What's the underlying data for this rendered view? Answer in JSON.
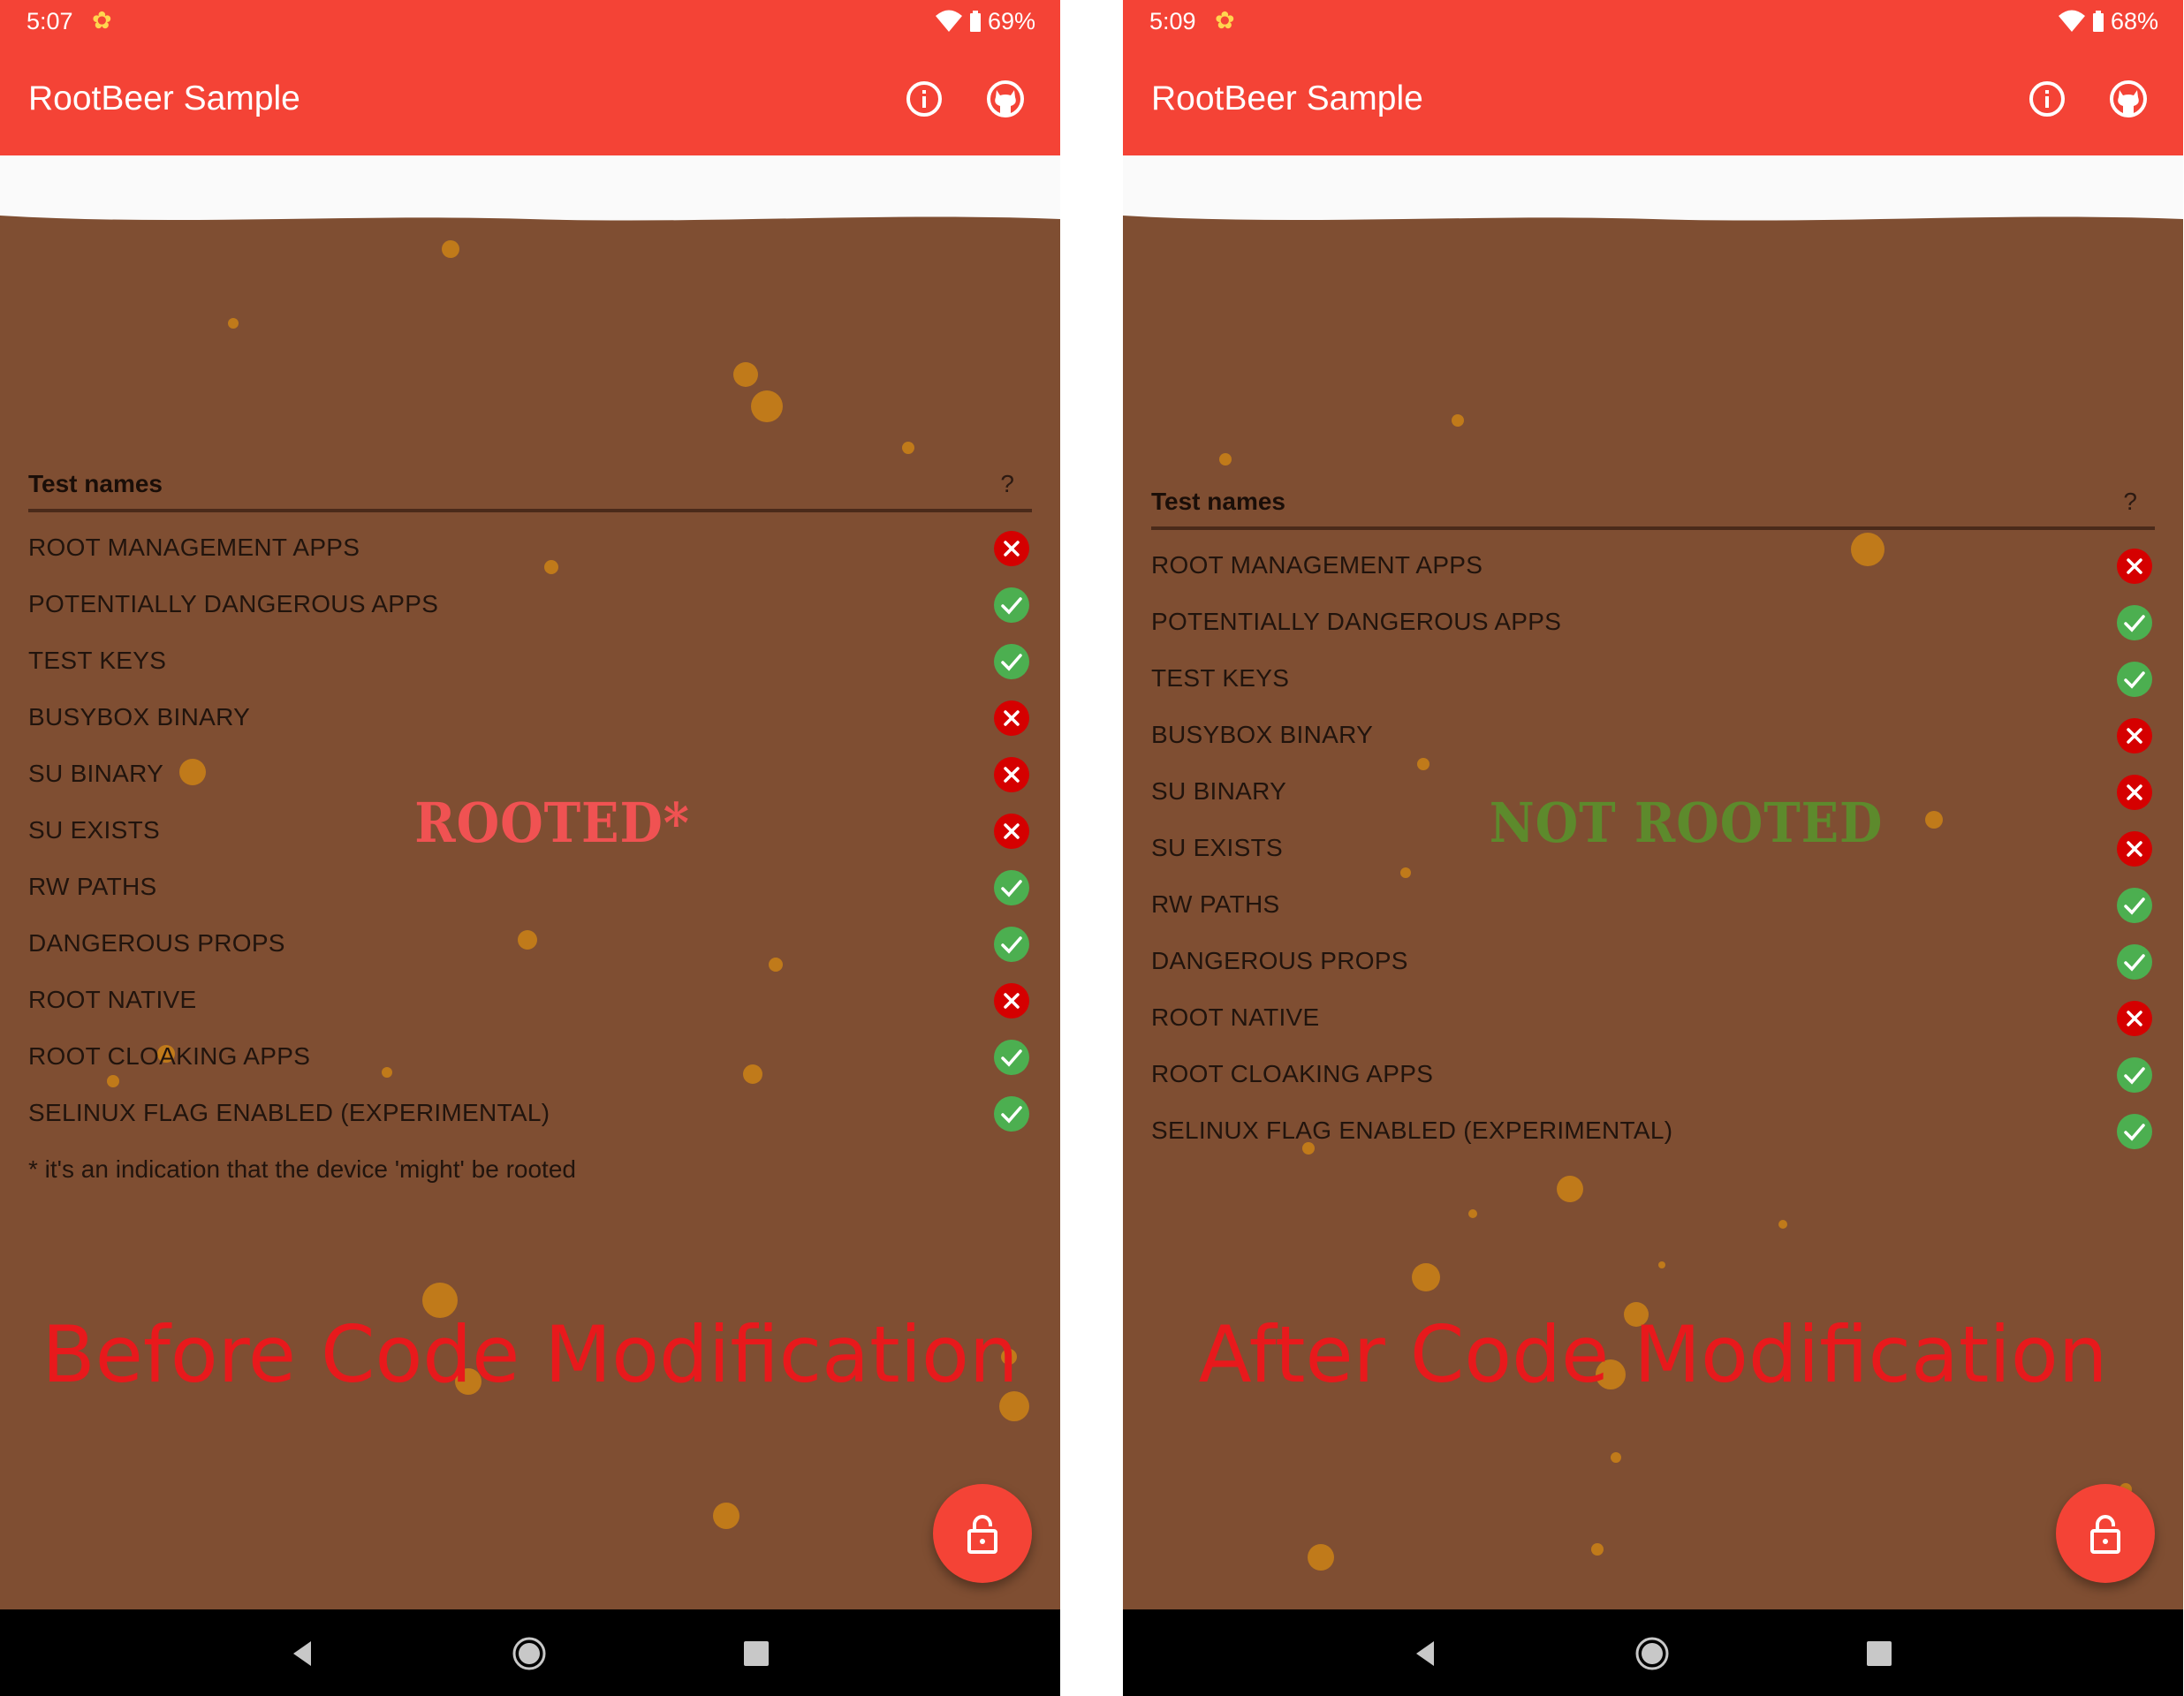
{
  "colors": {
    "primary": "#f44336",
    "beer_brown": "#7f4e32",
    "bubble": "#c07a1a",
    "fail_red": "#d50000",
    "pass_green": "#4caf50",
    "caption_red": "#e8191c"
  },
  "icons": {
    "info": "info-icon",
    "github": "github-icon",
    "pass": "check-circle-icon",
    "fail": "cross-circle-icon",
    "fab": "lock-open-icon"
  },
  "left": {
    "status": {
      "time": "5:07",
      "battery": "69%"
    },
    "app_title": "RootBeer Sample",
    "table": {
      "header_name": "Test names",
      "header_result": "?"
    },
    "tests": [
      {
        "name": "ROOT MANAGEMENT APPS",
        "passed": false
      },
      {
        "name": "POTENTIALLY DANGEROUS APPS",
        "passed": true
      },
      {
        "name": "TEST KEYS",
        "passed": true
      },
      {
        "name": "BUSYBOX BINARY",
        "passed": false
      },
      {
        "name": "SU BINARY",
        "passed": false
      },
      {
        "name": "SU EXISTS",
        "passed": false
      },
      {
        "name": "RW PATHS",
        "passed": true
      },
      {
        "name": "DANGEROUS PROPS",
        "passed": true
      },
      {
        "name": "ROOT NATIVE",
        "passed": false
      },
      {
        "name": "ROOT CLOAKING APPS",
        "passed": true
      },
      {
        "name": "SELINUX FLAG ENABLED (EXPERIMENTAL)",
        "passed": true
      }
    ],
    "result_stamp": "ROOTED*",
    "footnote": "* it's an indication that the device 'might' be rooted",
    "caption": "Before Code Modification"
  },
  "right": {
    "status": {
      "time": "5:09",
      "battery": "68%"
    },
    "app_title": "RootBeer Sample",
    "table": {
      "header_name": "Test names",
      "header_result": "?"
    },
    "tests": [
      {
        "name": "ROOT MANAGEMENT APPS",
        "passed": false
      },
      {
        "name": "POTENTIALLY DANGEROUS APPS",
        "passed": true
      },
      {
        "name": "TEST KEYS",
        "passed": true
      },
      {
        "name": "BUSYBOX BINARY",
        "passed": false
      },
      {
        "name": "SU BINARY",
        "passed": false
      },
      {
        "name": "SU EXISTS",
        "passed": false
      },
      {
        "name": "RW PATHS",
        "passed": true
      },
      {
        "name": "DANGEROUS PROPS",
        "passed": true
      },
      {
        "name": "ROOT NATIVE",
        "passed": false
      },
      {
        "name": "ROOT CLOAKING APPS",
        "passed": true
      },
      {
        "name": "SELINUX FLAG ENABLED (EXPERIMENTAL)",
        "passed": true
      }
    ],
    "result_stamp": "NOT ROOTED",
    "caption": "After Code Modification"
  }
}
